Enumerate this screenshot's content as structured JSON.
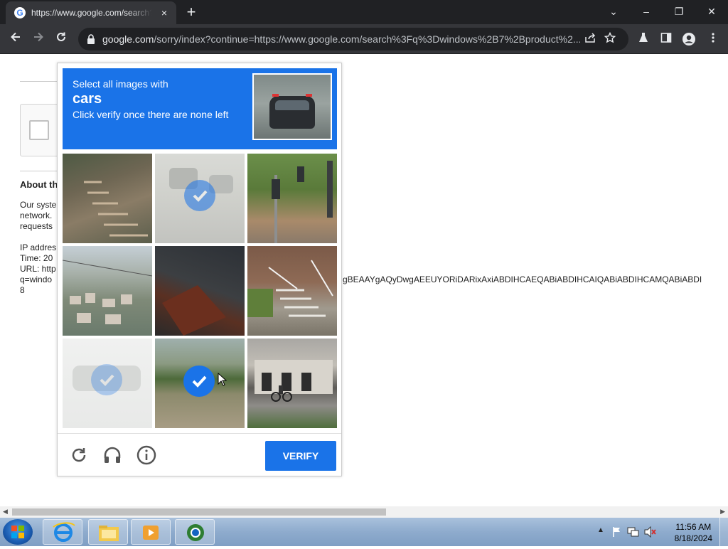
{
  "browser": {
    "tab_title": "https://www.google.com/search?",
    "tab_close": "×",
    "new_tab": "+",
    "window_controls": {
      "dropdown": "⌄",
      "minimize": "–",
      "restore": "❐",
      "close": "✕"
    },
    "url_host": "google.com",
    "url_rest": "/sorry/index?continue=https://www.google.com/search%3Fq%3Dwindows%2B7%2Bproduct%2..."
  },
  "page": {
    "about_heading": "About th",
    "paragraph_lines": [
      "Our syste",
      "network.",
      "requests"
    ],
    "ip_label": "IP addres",
    "time_label": "Time: 20",
    "url_label": "URL: http",
    "query_label": "q=windo",
    "query_tail": "gBEAAYgAQyDwgAEEUYORiDARixAxiABDIHCAEQABiABDIHCAIQABiABDIHCAMQABiABDI",
    "last_line": "8"
  },
  "captcha": {
    "instruction_line1": "Select all images with",
    "target_word": "cars",
    "instruction_line3": "Click verify once there are none left",
    "tiles": [
      {
        "name": "stairs-hillside",
        "selected": false
      },
      {
        "name": "street-car-faded",
        "selected": true
      },
      {
        "name": "traffic-lights",
        "selected": false
      },
      {
        "name": "city-hillside",
        "selected": false
      },
      {
        "name": "dark-roof",
        "selected": false
      },
      {
        "name": "house-stairs",
        "selected": false
      },
      {
        "name": "faded-car",
        "selected": true
      },
      {
        "name": "field-road",
        "selected": true
      },
      {
        "name": "building-cyclist",
        "selected": false
      }
    ],
    "verify_label": "VERIFY",
    "accent_color": "#1a73e8"
  },
  "taskbar": {
    "time": "11:56 AM",
    "date": "8/18/2024"
  }
}
